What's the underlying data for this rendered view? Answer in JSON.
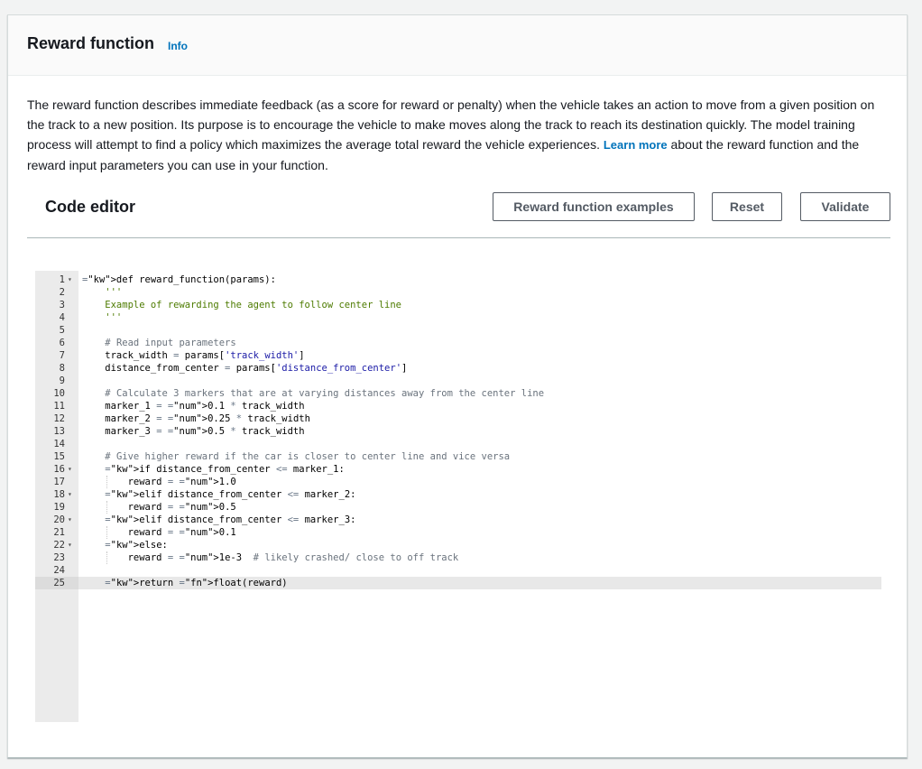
{
  "panel": {
    "title": "Reward function",
    "info_label": "Info",
    "description_part1": "The reward function describes immediate feedback (as a score for reward or penalty) when the vehicle takes an action to move from a given position on the track to a new position. Its purpose is to encourage the vehicle to make moves along the track to reach its destination quickly. The model training process will attempt to find a policy which maximizes the average total reward the vehicle experiences. ",
    "learn_more_label": "Learn more",
    "description_part2": " about the reward function and the reward input parameters you can use in your function."
  },
  "editor": {
    "title": "Code editor",
    "buttons": {
      "examples": "Reward function examples",
      "reset": "Reset",
      "validate": "Validate"
    },
    "active_line": 25,
    "lines": [
      "def reward_function(params):",
      "    '''",
      "    Example of rewarding the agent to follow center line",
      "    '''",
      "",
      "    # Read input parameters",
      "    track_width = params['track_width']",
      "    distance_from_center = params['distance_from_center']",
      "",
      "    # Calculate 3 markers that are at varying distances away from the center line",
      "    marker_1 = 0.1 * track_width",
      "    marker_2 = 0.25 * track_width",
      "    marker_3 = 0.5 * track_width",
      "",
      "    # Give higher reward if the car is closer to center line and vice versa",
      "    if distance_from_center <= marker_1:",
      "        reward = 1.0",
      "    elif distance_from_center <= marker_2:",
      "        reward = 0.5",
      "    elif distance_from_center <= marker_3:",
      "        reward = 0.1",
      "    else:",
      "        reward = 1e-3  # likely crashed/ close to off track",
      "",
      "    return float(reward)"
    ],
    "fold_lines": [
      1,
      16,
      18,
      20,
      22
    ]
  }
}
